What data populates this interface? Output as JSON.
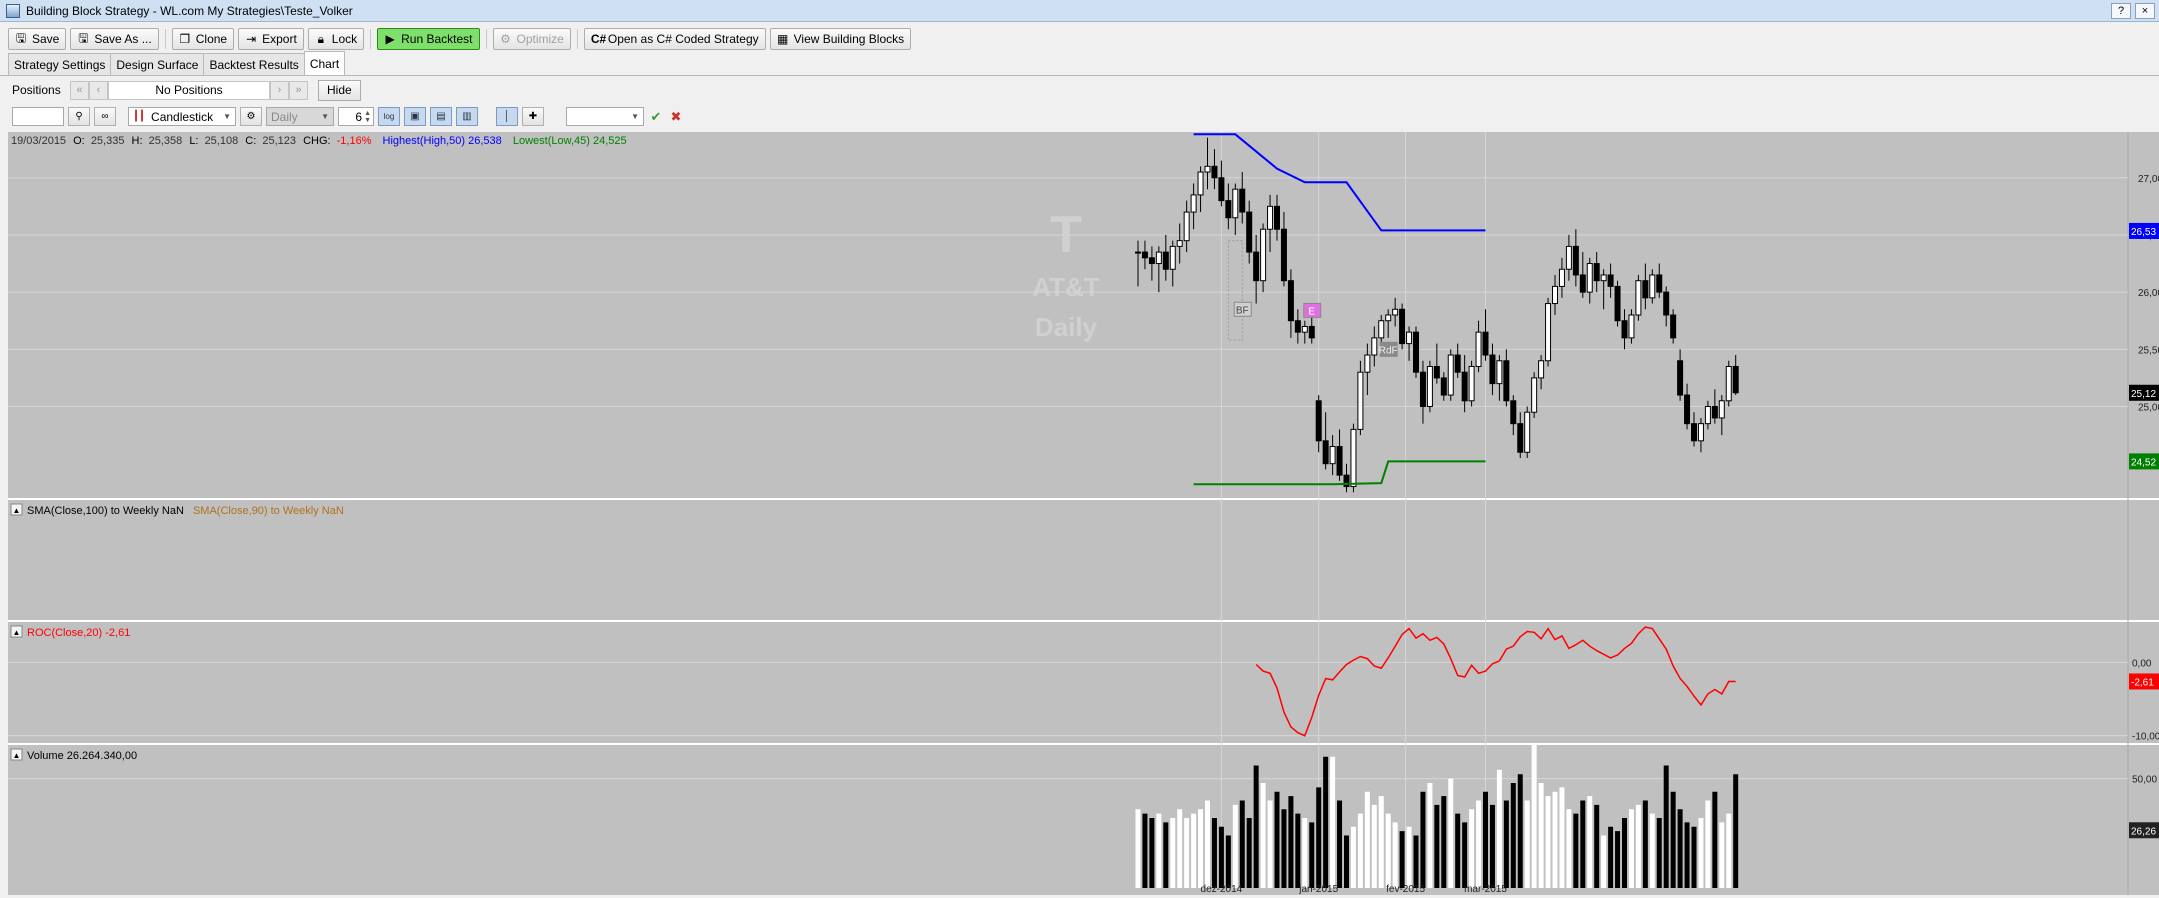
{
  "window": {
    "title": "Building Block Strategy - WL.com My Strategies\\Teste_Volker",
    "help": "?",
    "close": "×"
  },
  "toolbar": {
    "save": "Save",
    "save_as": "Save As ...",
    "clone": "Clone",
    "export": "Export",
    "lock": "Lock",
    "run_backtest": "Run Backtest",
    "optimize": "Optimize",
    "open_csharp": "Open as C# Coded Strategy",
    "view_blocks": "View Building Blocks"
  },
  "tabs": [
    "Strategy Settings",
    "Design Surface",
    "Backtest Results",
    "Chart"
  ],
  "positions": {
    "label": "Positions",
    "value": "No Positions",
    "hide": "Hide"
  },
  "chart_toolbar": {
    "symbol": "",
    "chart_style": "Candlestick",
    "scale": "Daily",
    "bar_spacing": "6",
    "log_label": "log"
  },
  "colors": {
    "highest": "#0000ff",
    "lowest": "#008000",
    "roc": "#ff0000",
    "sma90": "#b07020",
    "chg_neg": "#ff0000"
  },
  "header": {
    "date": "19/03/2015",
    "o_lbl": "O:",
    "o": "25,335",
    "h_lbl": "H:",
    "h": "25,358",
    "l_lbl": "L:",
    "l": "25,108",
    "c_lbl": "C:",
    "c": "25,123",
    "chg_lbl": "CHG:",
    "chg": "-1,16%",
    "highest": "Highest(High,50) 26,538",
    "lowest": "Lowest(Low,45) 24,525"
  },
  "watermark": {
    "logo": "T",
    "name": "AT&T",
    "scale": "Daily"
  },
  "panes": {
    "sma": {
      "label1": "SMA(Close,100) to Weekly NaN",
      "label2": "SMA(Close,90) to Weekly NaN"
    },
    "roc": {
      "label": "ROC(Close,20) -2,61",
      "ticks": [
        "0,00",
        "-10,00"
      ],
      "last": "-2,61"
    },
    "volume": {
      "label": "Volume 26.264.340,00",
      "ticks": [
        "50,00"
      ],
      "last": "26,26"
    }
  },
  "signals": [
    "BF",
    "E",
    "RdF"
  ],
  "chart_data": {
    "type": "candlestick",
    "price_axis": {
      "ticks": [
        "27,00",
        "26,50",
        "26,00",
        "25,50",
        "25,12",
        "25,00",
        "24,52"
      ],
      "range": [
        24.2,
        27.4
      ]
    },
    "x_labels": [
      "dez-2014",
      "jan-2015",
      "fev-2015",
      "mar-2015"
    ],
    "last_labels": {
      "highest": "26,53",
      "close": "25,12",
      "lowest": "24,52"
    },
    "candles": [
      [
        26.35,
        26.45,
        26.05,
        26.35
      ],
      [
        26.35,
        26.45,
        26.2,
        26.3
      ],
      [
        26.3,
        26.4,
        26.1,
        26.25
      ],
      [
        26.25,
        26.4,
        26.0,
        26.35
      ],
      [
        26.35,
        26.5,
        26.1,
        26.2
      ],
      [
        26.2,
        26.45,
        26.05,
        26.4
      ],
      [
        26.4,
        26.6,
        26.25,
        26.45
      ],
      [
        26.45,
        26.8,
        26.35,
        26.7
      ],
      [
        26.7,
        26.95,
        26.55,
        26.85
      ],
      [
        26.85,
        27.1,
        26.7,
        27.05
      ],
      [
        27.05,
        27.35,
        26.9,
        27.1
      ],
      [
        27.1,
        27.25,
        26.9,
        27.0
      ],
      [
        27.0,
        27.15,
        26.75,
        26.8
      ],
      [
        26.8,
        26.95,
        26.55,
        26.65
      ],
      [
        26.65,
        26.95,
        26.5,
        26.9
      ],
      [
        26.9,
        27.05,
        26.6,
        26.7
      ],
      [
        26.7,
        26.8,
        26.25,
        26.35
      ],
      [
        26.35,
        26.5,
        25.9,
        26.1
      ],
      [
        26.1,
        26.6,
        26.0,
        26.55
      ],
      [
        26.55,
        26.85,
        26.35,
        26.75
      ],
      [
        26.75,
        26.85,
        26.45,
        26.55
      ],
      [
        26.55,
        26.7,
        26.05,
        26.1
      ],
      [
        26.1,
        26.2,
        25.6,
        25.75
      ],
      [
        25.75,
        25.85,
        25.55,
        25.65
      ],
      [
        25.65,
        25.75,
        25.55,
        25.7
      ],
      [
        25.7,
        25.8,
        25.55,
        25.6
      ],
      [
        25.05,
        25.1,
        24.6,
        24.7
      ],
      [
        24.7,
        24.95,
        24.45,
        24.5
      ],
      [
        24.5,
        24.75,
        24.4,
        24.65
      ],
      [
        24.65,
        24.8,
        24.35,
        24.4
      ],
      [
        24.4,
        24.5,
        24.25,
        24.3
      ],
      [
        24.3,
        24.85,
        24.25,
        24.8
      ],
      [
        24.8,
        25.4,
        24.75,
        25.3
      ],
      [
        25.3,
        25.55,
        25.1,
        25.45
      ],
      [
        25.45,
        25.7,
        25.35,
        25.6
      ],
      [
        25.6,
        25.8,
        25.5,
        25.75
      ],
      [
        25.75,
        25.85,
        25.6,
        25.8
      ],
      [
        25.8,
        25.95,
        25.7,
        25.85
      ],
      [
        25.85,
        25.9,
        25.5,
        25.55
      ],
      [
        25.55,
        25.7,
        25.4,
        25.65
      ],
      [
        25.65,
        25.7,
        25.25,
        25.3
      ],
      [
        25.3,
        25.4,
        24.85,
        25.0
      ],
      [
        25.0,
        25.4,
        24.95,
        25.35
      ],
      [
        25.35,
        25.55,
        25.2,
        25.25
      ],
      [
        25.25,
        25.3,
        25.05,
        25.1
      ],
      [
        25.1,
        25.5,
        25.05,
        25.45
      ],
      [
        25.45,
        25.55,
        25.25,
        25.3
      ],
      [
        25.3,
        25.45,
        24.95,
        25.05
      ],
      [
        25.05,
        25.4,
        25.0,
        25.35
      ],
      [
        25.35,
        25.75,
        25.3,
        25.65
      ],
      [
        25.65,
        25.85,
        25.4,
        25.45
      ],
      [
        25.45,
        25.55,
        25.1,
        25.2
      ],
      [
        25.2,
        25.45,
        25.05,
        25.4
      ],
      [
        25.4,
        25.5,
        25.0,
        25.05
      ],
      [
        25.05,
        25.1,
        24.75,
        24.85
      ],
      [
        24.85,
        24.95,
        24.55,
        24.6
      ],
      [
        24.6,
        25.0,
        24.55,
        24.95
      ],
      [
        24.95,
        25.3,
        24.9,
        25.25
      ],
      [
        25.25,
        25.45,
        25.15,
        25.4
      ],
      [
        25.4,
        25.95,
        25.35,
        25.9
      ],
      [
        25.9,
        26.15,
        25.8,
        26.05
      ],
      [
        26.05,
        26.3,
        25.95,
        26.2
      ],
      [
        26.2,
        26.5,
        26.1,
        26.4
      ],
      [
        26.4,
        26.55,
        26.05,
        26.15
      ],
      [
        26.15,
        26.35,
        25.95,
        26.0
      ],
      [
        26.0,
        26.3,
        25.9,
        26.25
      ],
      [
        26.25,
        26.35,
        26.0,
        26.1
      ],
      [
        26.1,
        26.2,
        25.85,
        26.15
      ],
      [
        26.15,
        26.25,
        25.95,
        26.05
      ],
      [
        26.05,
        26.1,
        25.7,
        25.75
      ],
      [
        25.75,
        25.85,
        25.5,
        25.6
      ],
      [
        25.6,
        25.85,
        25.55,
        25.8
      ],
      [
        25.8,
        26.15,
        25.75,
        26.1
      ],
      [
        26.1,
        26.25,
        25.85,
        25.95
      ],
      [
        25.95,
        26.2,
        25.9,
        26.15
      ],
      [
        26.15,
        26.25,
        25.95,
        26.0
      ],
      [
        26.0,
        26.05,
        25.7,
        25.8
      ],
      [
        25.8,
        25.85,
        25.55,
        25.6
      ],
      [
        25.4,
        25.5,
        25.05,
        25.1
      ],
      [
        25.1,
        25.2,
        24.8,
        24.85
      ],
      [
        24.85,
        24.95,
        24.65,
        24.7
      ],
      [
        24.7,
        24.9,
        24.6,
        24.85
      ],
      [
        24.85,
        25.05,
        24.8,
        25.0
      ],
      [
        25.0,
        25.15,
        24.85,
        24.9
      ],
      [
        24.9,
        25.1,
        24.75,
        25.05
      ],
      [
        25.05,
        25.4,
        25.0,
        25.35
      ],
      [
        25.35,
        25.45,
        25.1,
        25.12
      ]
    ],
    "highest_line": [
      [
        8,
        27.38
      ],
      [
        14,
        27.38
      ],
      [
        20,
        27.08
      ],
      [
        24,
        26.96
      ],
      [
        30,
        26.96
      ],
      [
        35,
        26.54
      ],
      [
        50,
        26.54
      ]
    ],
    "lowest_line": [
      [
        8,
        24.32
      ],
      [
        28,
        24.32
      ],
      [
        35,
        24.33
      ],
      [
        36,
        24.52
      ],
      [
        50,
        24.52
      ]
    ],
    "roc": [
      -0.3,
      -1.2,
      -1.5,
      -3.5,
      -6.8,
      -8.8,
      -9.6,
      -10.0,
      -7.5,
      -4.5,
      -2.2,
      -2.4,
      -1.3,
      -0.3,
      0.3,
      0.8,
      0.5,
      -0.5,
      -0.8,
      0.6,
      2.2,
      3.8,
      4.6,
      3.3,
      3.9,
      3.0,
      3.4,
      2.5,
      0.5,
      -1.8,
      -2.0,
      -0.4,
      -1.5,
      -1.2,
      -0.2,
      0.2,
      1.8,
      2.2,
      3.5,
      4.2,
      4.1,
      3.2,
      4.6,
      3.1,
      3.6,
      1.9,
      2.4,
      3.0,
      2.2,
      1.6,
      1.1,
      0.6,
      1.0,
      1.9,
      2.6,
      3.9,
      4.8,
      4.6,
      3.2,
      1.8,
      -0.5,
      -2.2,
      -3.3,
      -4.6,
      -5.8,
      -4.3,
      -3.7,
      -4.3,
      -2.6,
      -2.61
    ],
    "volume": [
      18,
      17,
      16,
      17,
      15,
      16,
      18,
      16,
      17,
      18,
      20,
      16,
      14,
      12,
      19,
      20,
      16,
      28,
      24,
      20,
      22,
      18,
      21,
      17,
      16,
      15,
      23,
      30,
      30,
      20,
      12,
      14,
      17,
      22,
      19,
      21,
      17,
      15,
      13,
      14,
      12,
      22,
      24,
      19,
      21,
      25,
      17,
      15,
      18,
      20,
      22,
      19,
      27,
      20,
      24,
      26,
      20,
      33,
      24,
      21,
      22,
      23,
      18,
      17,
      20,
      21,
      19,
      12,
      14,
      13,
      16,
      18,
      19,
      20,
      17,
      16,
      28,
      22,
      18,
      15,
      14,
      16,
      20,
      22,
      15,
      17,
      26
    ]
  }
}
